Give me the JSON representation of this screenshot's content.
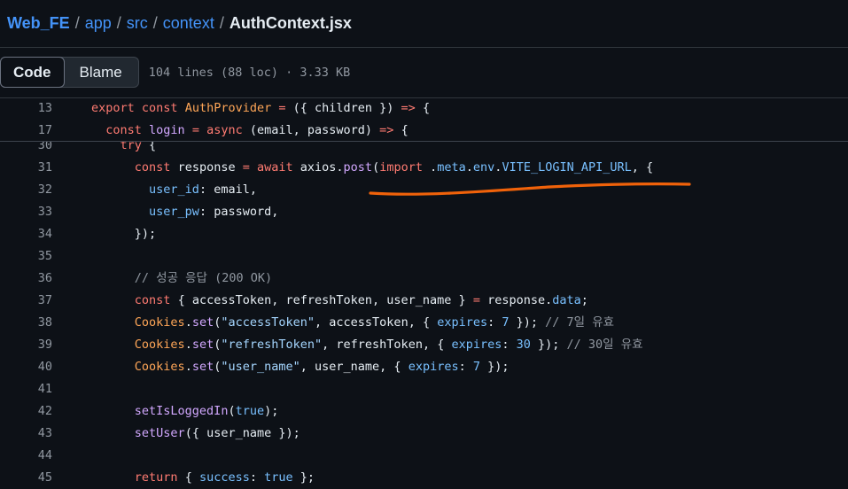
{
  "breadcrumb": {
    "repo": "Web_FE",
    "sep": "/",
    "app": "app",
    "src": "src",
    "context": "context",
    "file": "AuthContext.jsx"
  },
  "toolbar": {
    "code_label": "Code",
    "blame_label": "Blame",
    "file_info": "104 lines (88 loc) · 3.33 KB"
  },
  "code": {
    "sticky": [
      {
        "num": "13",
        "tokens": [
          [
            "kw",
            "export "
          ],
          [
            "kw",
            "const "
          ],
          [
            "cl",
            "AuthProvider"
          ],
          [
            "kw",
            " = "
          ],
          [
            "",
            "({ children }) "
          ],
          [
            "kw",
            "=>"
          ],
          [
            "",
            " {"
          ]
        ]
      },
      {
        "num": "17",
        "tokens": [
          [
            "",
            "  "
          ],
          [
            "kw",
            "const "
          ],
          [
            "fn",
            "login"
          ],
          [
            "kw",
            " = "
          ],
          [
            "kw",
            "async "
          ],
          [
            "",
            "(email, password) "
          ],
          [
            "kw",
            "=>"
          ],
          [
            "",
            " {"
          ]
        ]
      }
    ],
    "lines": [
      {
        "num": "30",
        "tokens": [
          [
            "",
            "    "
          ],
          [
            "kw",
            "try"
          ],
          [
            "",
            " {"
          ]
        ]
      },
      {
        "num": "31",
        "tokens": [
          [
            "",
            "      "
          ],
          [
            "kw",
            "const "
          ],
          [
            "",
            "response "
          ],
          [
            "kw",
            "= "
          ],
          [
            "kw",
            "await "
          ],
          [
            "",
            "axios."
          ],
          [
            "fn",
            "post"
          ],
          [
            "",
            "("
          ],
          [
            "kw",
            "import"
          ],
          [
            "",
            " ."
          ],
          [
            "pr",
            "meta"
          ],
          [
            "",
            "."
          ],
          [
            "pr",
            "env"
          ],
          [
            "",
            "."
          ],
          [
            "pr",
            "VITE_LOGIN_API_URL"
          ],
          [
            "",
            ", {"
          ]
        ]
      },
      {
        "num": "32",
        "tokens": [
          [
            "",
            "        "
          ],
          [
            "pr",
            "user_id"
          ],
          [
            "",
            ": email,"
          ]
        ]
      },
      {
        "num": "33",
        "tokens": [
          [
            "",
            "        "
          ],
          [
            "pr",
            "user_pw"
          ],
          [
            "",
            ": password,"
          ]
        ]
      },
      {
        "num": "34",
        "tokens": [
          [
            "",
            "      });"
          ]
        ]
      },
      {
        "num": "35",
        "tokens": []
      },
      {
        "num": "36",
        "tokens": [
          [
            "",
            "      "
          ],
          [
            "cm",
            "// 성공 응답 (200 OK)"
          ]
        ]
      },
      {
        "num": "37",
        "tokens": [
          [
            "",
            "      "
          ],
          [
            "kw",
            "const "
          ],
          [
            "",
            "{ accessToken, refreshToken, user_name } "
          ],
          [
            "kw",
            "= "
          ],
          [
            "",
            "response."
          ],
          [
            "pr",
            "data"
          ],
          [
            "",
            ";"
          ]
        ]
      },
      {
        "num": "38",
        "tokens": [
          [
            "",
            "      "
          ],
          [
            "cl",
            "Cookies"
          ],
          [
            "",
            "."
          ],
          [
            "fn",
            "set"
          ],
          [
            "",
            "("
          ],
          [
            "st",
            "\"accessToken\""
          ],
          [
            "",
            ", accessToken, { "
          ],
          [
            "pr",
            "expires"
          ],
          [
            "",
            ": "
          ],
          [
            "nm",
            "7"
          ],
          [
            "",
            " }); "
          ],
          [
            "cm",
            "// 7일 유효"
          ]
        ]
      },
      {
        "num": "39",
        "tokens": [
          [
            "",
            "      "
          ],
          [
            "cl",
            "Cookies"
          ],
          [
            "",
            "."
          ],
          [
            "fn",
            "set"
          ],
          [
            "",
            "("
          ],
          [
            "st",
            "\"refreshToken\""
          ],
          [
            "",
            ", refreshToken, { "
          ],
          [
            "pr",
            "expires"
          ],
          [
            "",
            ": "
          ],
          [
            "nm",
            "30"
          ],
          [
            "",
            " }); "
          ],
          [
            "cm",
            "// 30일 유효"
          ]
        ]
      },
      {
        "num": "40",
        "tokens": [
          [
            "",
            "      "
          ],
          [
            "cl",
            "Cookies"
          ],
          [
            "",
            "."
          ],
          [
            "fn",
            "set"
          ],
          [
            "",
            "("
          ],
          [
            "st",
            "\"user_name\""
          ],
          [
            "",
            ", user_name, { "
          ],
          [
            "pr",
            "expires"
          ],
          [
            "",
            ": "
          ],
          [
            "nm",
            "7"
          ],
          [
            "",
            " });"
          ]
        ]
      },
      {
        "num": "41",
        "tokens": []
      },
      {
        "num": "42",
        "tokens": [
          [
            "",
            "      "
          ],
          [
            "fn",
            "setIsLoggedIn"
          ],
          [
            "",
            "("
          ],
          [
            "nm",
            "true"
          ],
          [
            "",
            ");"
          ]
        ]
      },
      {
        "num": "43",
        "tokens": [
          [
            "",
            "      "
          ],
          [
            "fn",
            "setUser"
          ],
          [
            "",
            "({ user_name });"
          ]
        ]
      },
      {
        "num": "44",
        "tokens": []
      },
      {
        "num": "45",
        "tokens": [
          [
            "",
            "      "
          ],
          [
            "kw",
            "return "
          ],
          [
            "",
            "{ "
          ],
          [
            "pr",
            "success"
          ],
          [
            "",
            ": "
          ],
          [
            "nm",
            "true"
          ],
          [
            "",
            " };"
          ]
        ]
      }
    ]
  },
  "colors": {
    "annotation": "#f0620a",
    "keyword": "#ff7b72",
    "function": "#d2a8ff",
    "property": "#79c0ff",
    "string": "#a5d6ff",
    "comment": "#9198a1",
    "class": "#ffa657",
    "link": "#4493f8"
  }
}
